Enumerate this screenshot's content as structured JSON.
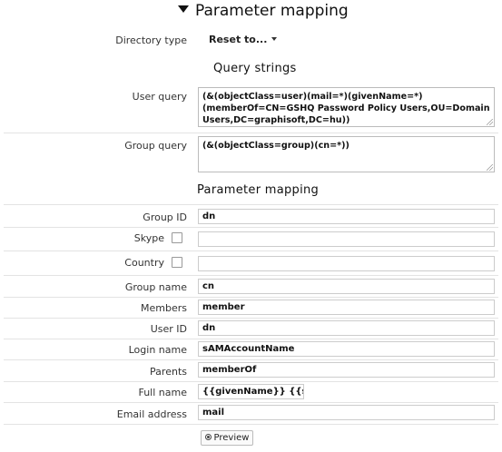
{
  "header": {
    "title": "Parameter mapping"
  },
  "directory_type": {
    "label": "Directory type",
    "value": "Reset to..."
  },
  "query_strings": {
    "heading": "Query strings",
    "user_query": {
      "label": "User query",
      "value": "(&(objectClass=user)(mail=*)(givenName=*)(memberOf=CN=GSHQ Password Policy Users,OU=Domain Users,DC=graphisoft,DC=hu))"
    },
    "group_query": {
      "label": "Group query",
      "value": "(&(objectClass=group)(cn=*))"
    }
  },
  "mapping": {
    "heading": "Parameter mapping",
    "fields": {
      "group_id": {
        "label": "Group ID",
        "value": "dn"
      },
      "skype": {
        "label": "Skype",
        "value": "",
        "checked": false
      },
      "country": {
        "label": "Country",
        "value": "",
        "checked": false
      },
      "group_name": {
        "label": "Group name",
        "value": "cn"
      },
      "members": {
        "label": "Members",
        "value": "member"
      },
      "user_id": {
        "label": "User ID",
        "value": "dn"
      },
      "login_name": {
        "label": "Login name",
        "value": "sAMAccountName"
      },
      "parents": {
        "label": "Parents",
        "value": "memberOf"
      },
      "full_name": {
        "label": "Full name",
        "value": "{{givenName}} {{sn}}"
      },
      "email_address": {
        "label": "Email address",
        "value": "mail"
      }
    }
  },
  "preview_button": {
    "label": "Preview",
    "icon": "preview-icon"
  }
}
